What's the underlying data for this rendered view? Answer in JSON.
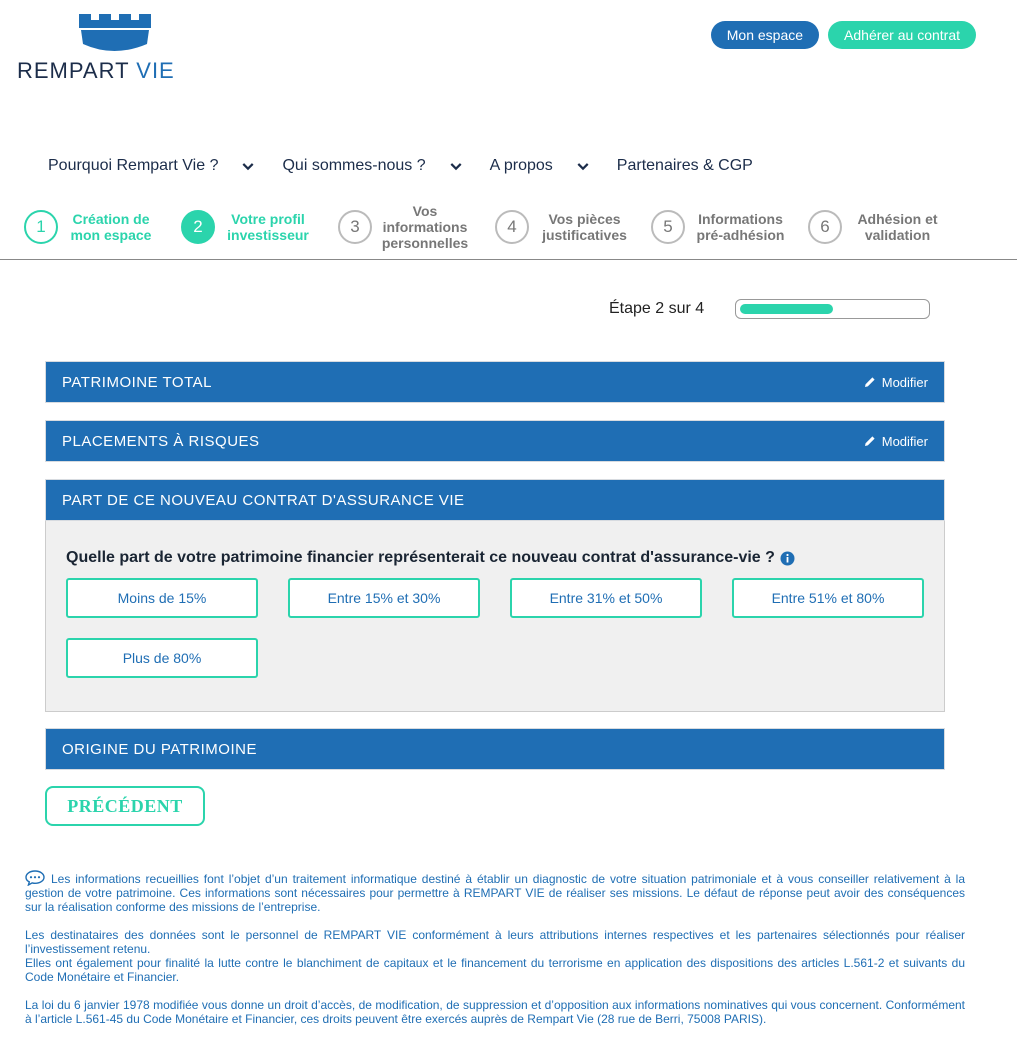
{
  "brand": {
    "name_part1": "REMPART",
    "name_part2": "VIE"
  },
  "header": {
    "my_space": "Mon espace",
    "join": "Adhérer au contrat"
  },
  "nav": {
    "items": [
      {
        "label": "Pourquoi Rempart Vie ?",
        "has_dropdown": true
      },
      {
        "label": "Qui sommes-nous ?",
        "has_dropdown": true
      },
      {
        "label": "A propos",
        "has_dropdown": true
      },
      {
        "label": "Partenaires & CGP",
        "has_dropdown": false
      }
    ]
  },
  "steps": [
    {
      "number": "1",
      "label": "Création de\nmon espace",
      "state": "done"
    },
    {
      "number": "2",
      "label": "Votre profil\ninvestisseur",
      "state": "active"
    },
    {
      "number": "3",
      "label": "Vos\ninformations\npersonnelles",
      "state": "todo"
    },
    {
      "number": "4",
      "label": "Vos pièces\njustificatives",
      "state": "todo"
    },
    {
      "number": "5",
      "label": "Informations\npré-adhésion",
      "state": "todo"
    },
    {
      "number": "6",
      "label": "Adhésion et\nvalidation",
      "state": "todo"
    }
  ],
  "progress": {
    "label": "Étape 2 sur 4",
    "fraction": 0.5
  },
  "sections": {
    "patrimoine_total": {
      "title": "PATRIMOINE TOTAL",
      "modify": "Modifier"
    },
    "placements": {
      "title": "PLACEMENTS À RISQUES",
      "modify": "Modifier"
    },
    "part_contrat": {
      "title": "PART DE CE NOUVEAU CONTRAT D'ASSURANCE VIE",
      "question": "Quelle part de votre patrimoine financier représenterait ce nouveau contrat d'assurance-vie ?",
      "options": [
        "Moins de 15%",
        "Entre 15% et 30%",
        "Entre 31% et 50%",
        "Entre 51% et 80%",
        "Plus de 80%"
      ]
    },
    "origine": {
      "title": "ORIGINE DU PATRIMOINE"
    }
  },
  "buttons": {
    "previous": "PRÉCÉDENT"
  },
  "legal": {
    "p1": "Les informations recueillies font l’objet d’un traitement informatique destiné à établir un diagnostic de votre situation patrimoniale et à vous conseiller relativement à la gestion de votre patrimoine. Ces informations sont nécessaires pour permettre à REMPART VIE de réaliser ses missions. Le défaut de réponse peut avoir des conséquences sur la réalisation conforme des missions de l’entreprise.",
    "p2": "Les destinataires des données sont le personnel de REMPART VIE conformément à leurs attributions internes respectives et les partenaires sélectionnés pour réaliser l’investissement retenu.",
    "p3": "Elles ont également pour finalité la lutte contre le blanchiment de capitaux et le financement du terrorisme en application des dispositions des articles L.561-2 et suivants du Code Monétaire et Financier.",
    "p4": "La loi du 6 janvier 1978 modifiée vous donne un droit d’accès, de modification, de suppression et d’opposition aux informations nominatives qui vous concernent. Conformément à l’article L.561-45 du Code Monétaire et Financier, ces droits peuvent être exercés auprès de Rempart Vie (28 rue de Berri, 75008 PARIS)."
  },
  "colors": {
    "primary_blue": "#1f6eb4",
    "accent_teal": "#2bd4ac",
    "navy": "#1c2d4a"
  }
}
